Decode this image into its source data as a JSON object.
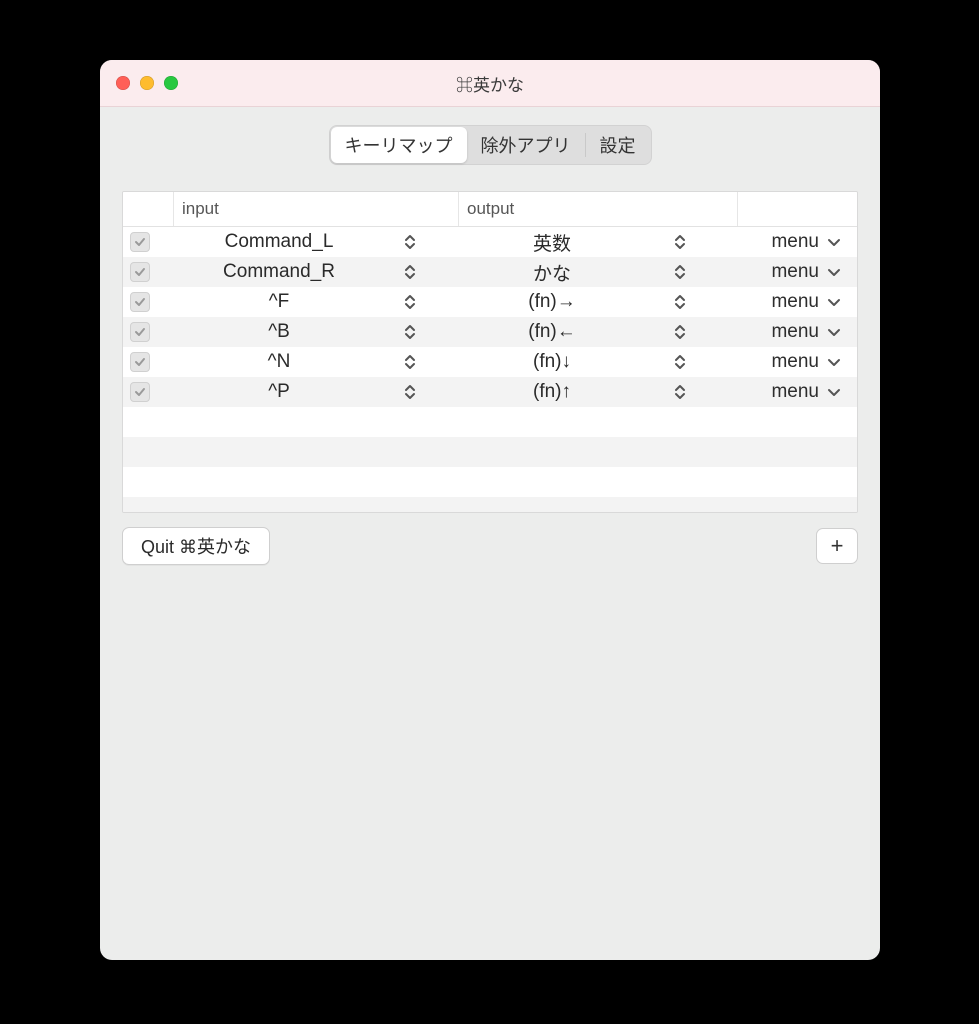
{
  "window": {
    "title": "⌘英かな"
  },
  "tabs": {
    "keymap": "キーリマップ",
    "exclude": "除外アプリ",
    "settings": "設定",
    "active": "keymap"
  },
  "headers": {
    "input": "input",
    "output": "output"
  },
  "rows": [
    {
      "checked": true,
      "input": "Command_L",
      "output": "英数",
      "menu": "menu"
    },
    {
      "checked": true,
      "input": "Command_R",
      "output": "かな",
      "menu": "menu"
    },
    {
      "checked": true,
      "input": "^F",
      "output": "(fn)→",
      "menu": "menu"
    },
    {
      "checked": true,
      "input": "^B",
      "output": "(fn)←",
      "menu": "menu"
    },
    {
      "checked": true,
      "input": "^N",
      "output": "(fn)↓",
      "menu": "menu"
    },
    {
      "checked": true,
      "input": "^P",
      "output": "(fn)↑",
      "menu": "menu"
    }
  ],
  "buttons": {
    "quit": "Quit ⌘英かな",
    "add": "+"
  }
}
